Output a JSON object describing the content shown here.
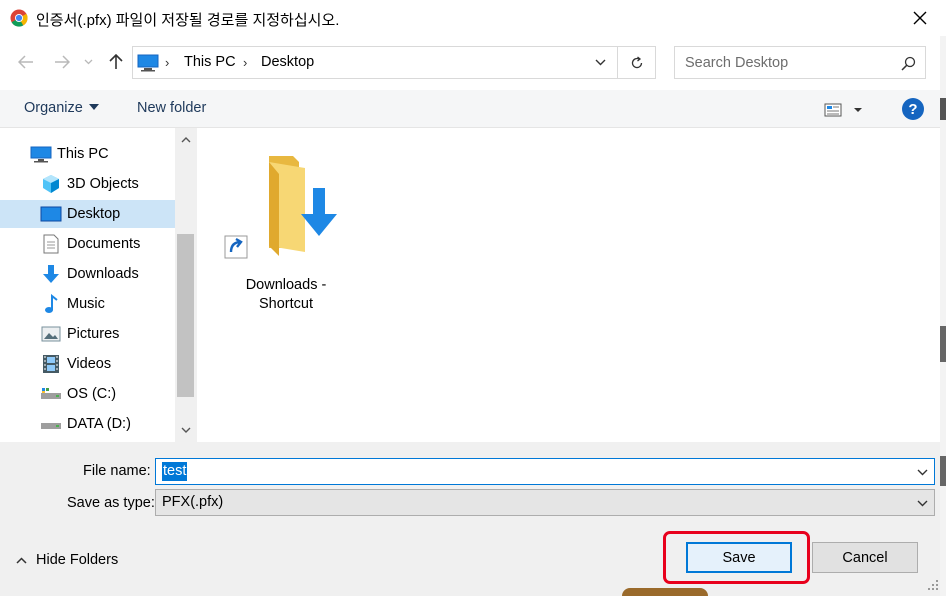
{
  "window": {
    "title": "인증서(.pfx) 파일이 저장될 경로를 지정하십시오."
  },
  "address": {
    "segments": [
      "This PC",
      "Desktop"
    ]
  },
  "search": {
    "placeholder": "Search Desktop"
  },
  "toolbar": {
    "organize_label": "Organize",
    "new_folder_label": "New folder",
    "help_label": "?"
  },
  "sidebar": {
    "items": [
      {
        "label": "This PC",
        "icon": "computer-icon"
      },
      {
        "label": "3D Objects",
        "icon": "cube-icon"
      },
      {
        "label": "Desktop",
        "icon": "desktop-icon",
        "selected": true
      },
      {
        "label": "Documents",
        "icon": "document-icon"
      },
      {
        "label": "Downloads",
        "icon": "download-arrow-icon"
      },
      {
        "label": "Music",
        "icon": "music-note-icon"
      },
      {
        "label": "Pictures",
        "icon": "pictures-icon"
      },
      {
        "label": "Videos",
        "icon": "film-icon"
      },
      {
        "label": "OS (C:)",
        "icon": "drive-icon"
      },
      {
        "label": "DATA (D:)",
        "icon": "drive-icon"
      }
    ]
  },
  "files": [
    {
      "line1": "Downloads -",
      "line2": "Shortcut",
      "icon": "folder-shortcut-icon"
    }
  ],
  "form": {
    "file_name_label": "File name:",
    "file_name_value": "test",
    "save_type_label": "Save as type:",
    "save_type_value": "PFX(.pfx)"
  },
  "footer": {
    "hide_folders_label": "Hide Folders",
    "save_label": "Save",
    "cancel_label": "Cancel"
  },
  "colors": {
    "accent": "#0078d7",
    "selection": "#cce4f7",
    "highlight": "#e8001c"
  }
}
